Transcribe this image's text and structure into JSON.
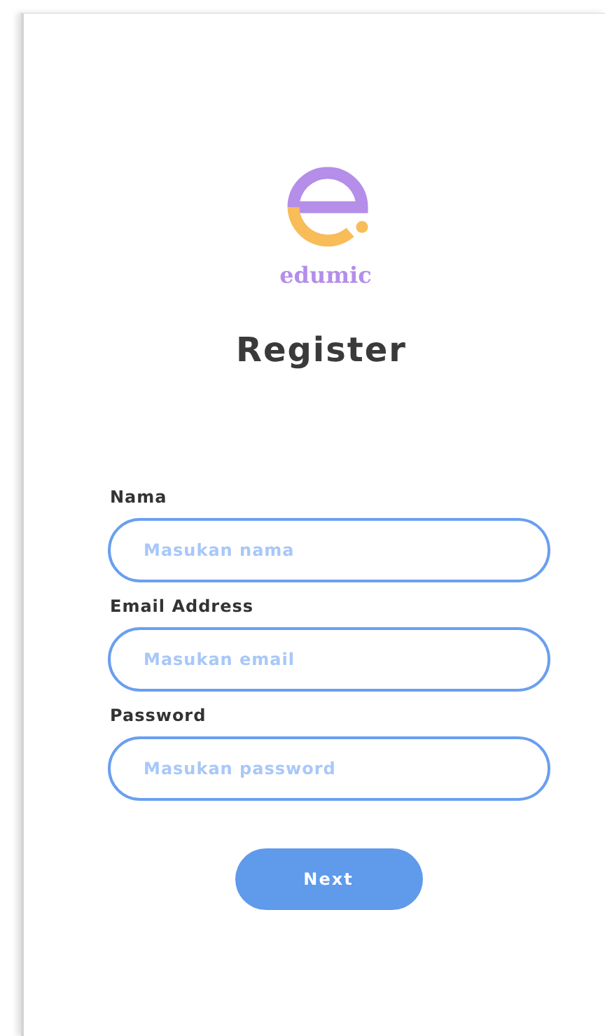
{
  "brand": {
    "name": "edumic"
  },
  "title": "Register",
  "fields": [
    {
      "label": "Nama",
      "placeholder": "Masukan nama"
    },
    {
      "label": "Email Address",
      "placeholder": "Masukan email"
    },
    {
      "label": "Password",
      "placeholder": "Masukan password"
    }
  ],
  "button": "Next"
}
